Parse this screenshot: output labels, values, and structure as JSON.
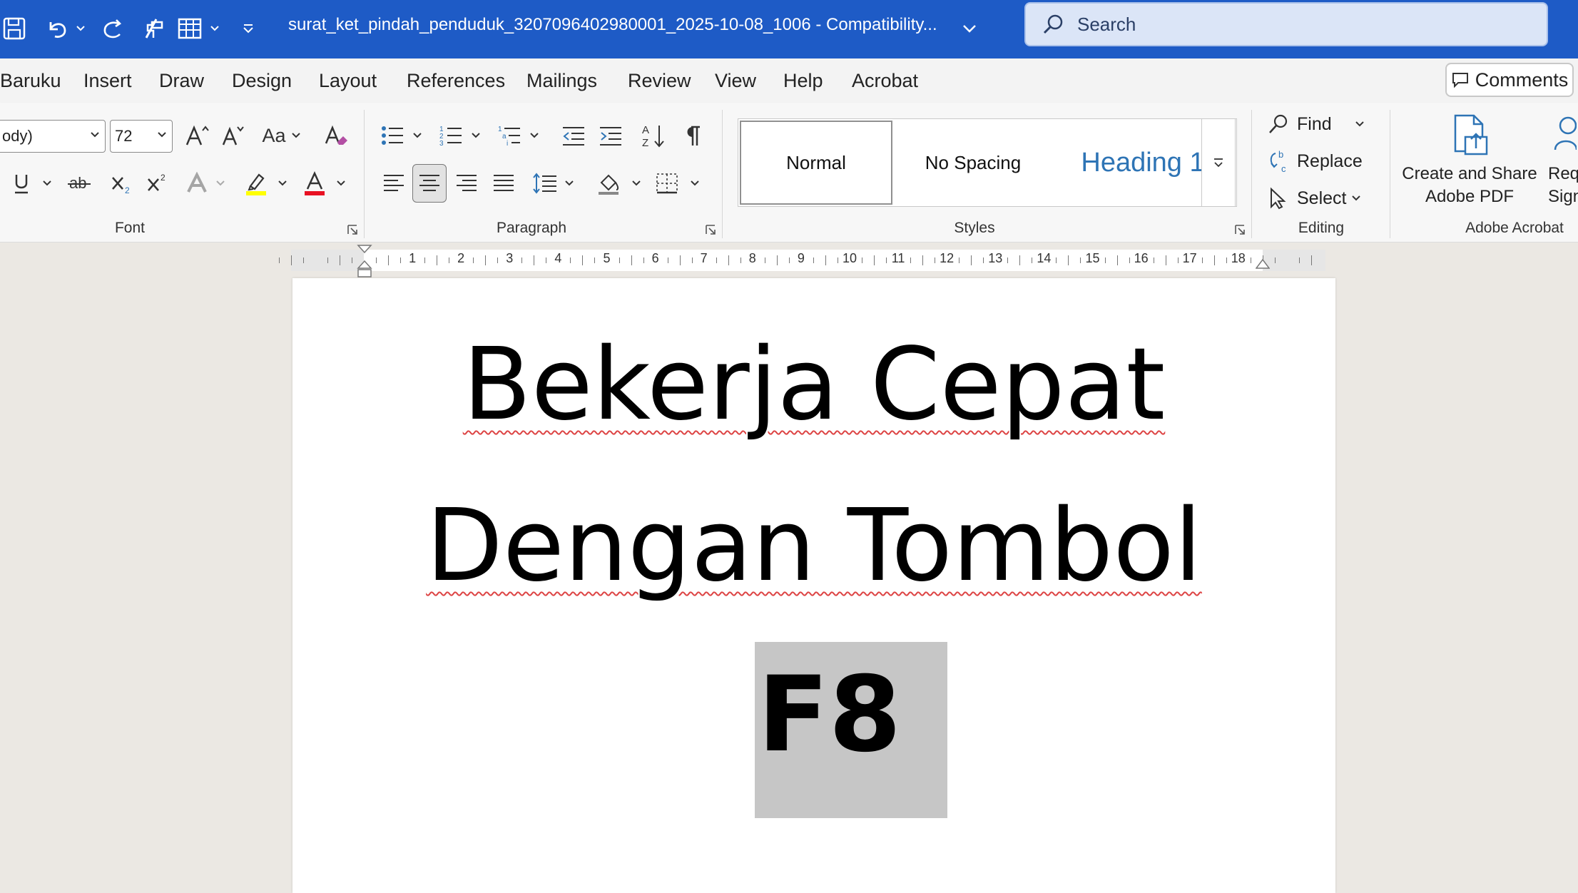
{
  "titlebar": {
    "document_title": "surat_ket_pindah_penduduk_3207096402980001_2025-10-08_1006  -  Compatibility...",
    "search_placeholder": "Search"
  },
  "tabs": [
    "Baruku",
    "Insert",
    "Draw",
    "Design",
    "Layout",
    "References",
    "Mailings",
    "Review",
    "View",
    "Help",
    "Acrobat"
  ],
  "comments_label": "Comments",
  "font": {
    "name": "ody)",
    "size": "72",
    "change_case_label": "Aa",
    "group_label": "Font"
  },
  "paragraph": {
    "group_label": "Paragraph"
  },
  "styles": {
    "items": [
      "Normal",
      "No Spacing",
      "Heading 1"
    ],
    "group_label": "Styles"
  },
  "editing": {
    "find": "Find",
    "replace": "Replace",
    "select": "Select",
    "group_label": "Editing"
  },
  "acrobat": {
    "create_share_line1": "Create and Share",
    "create_share_line2": "Adobe PDF",
    "request_line1": "Req",
    "request_line2": "Sign",
    "group_label": "Adobe Acrobat"
  },
  "ruler": {
    "numbers": [
      "1",
      "2",
      "3",
      "4",
      "5",
      "6",
      "7",
      "8",
      "9",
      "10",
      "11",
      "12",
      "13",
      "14",
      "15",
      "16",
      "17",
      "18"
    ]
  },
  "document": {
    "line1": "Bekerja Cepat",
    "line2": "Dengan Tombol",
    "line3": "F8"
  },
  "colors": {
    "titlebar": "#1e5bc6",
    "highlight": "#ffff00",
    "font_color": "#e81123",
    "heading_blue": "#2e74b5",
    "selection": "#c6c6c6"
  }
}
